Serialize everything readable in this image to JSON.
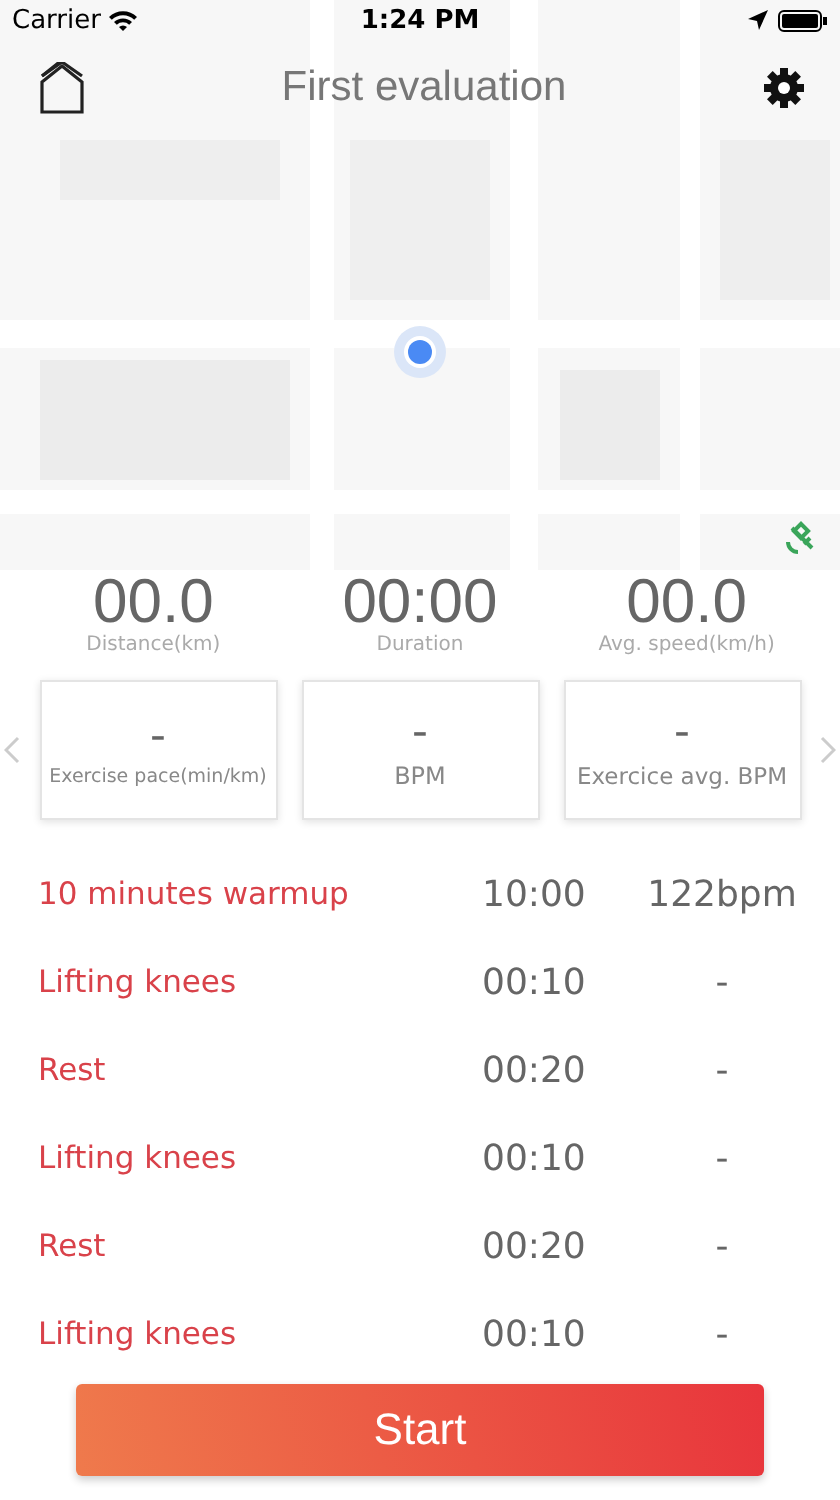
{
  "status_bar": {
    "carrier": "Carrier",
    "time": "1:24 PM"
  },
  "header": {
    "title": "First evaluation"
  },
  "stats": [
    {
      "value": "00.0",
      "label": "Distance(km)"
    },
    {
      "value": "00:00",
      "label": "Duration"
    },
    {
      "value": "00.0",
      "label": "Avg. speed(km/h)"
    }
  ],
  "cards": [
    {
      "value": "-",
      "label": "Exercise pace(min/km)"
    },
    {
      "value": "-",
      "label": "BPM"
    },
    {
      "value": "-",
      "label": "Exercice avg. BPM"
    }
  ],
  "exercises": [
    {
      "name": "10 minutes warmup",
      "duration": "10:00",
      "bpm": "122bpm"
    },
    {
      "name": "Lifting knees",
      "duration": "00:10",
      "bpm": "-"
    },
    {
      "name": "Rest",
      "duration": "00:20",
      "bpm": "-"
    },
    {
      "name": "Lifting knees",
      "duration": "00:10",
      "bpm": "-"
    },
    {
      "name": "Rest",
      "duration": "00:20",
      "bpm": "-"
    },
    {
      "name": "Lifting knees",
      "duration": "00:10",
      "bpm": "-"
    }
  ],
  "start_button": "Start"
}
